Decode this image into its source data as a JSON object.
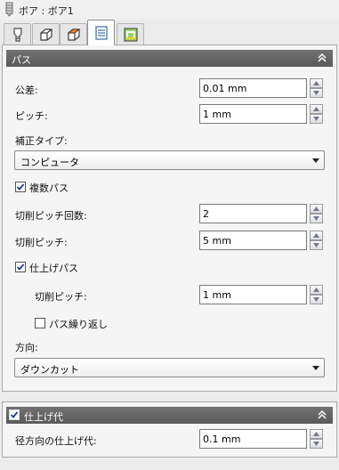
{
  "window": {
    "title": "ボア : ボア1"
  },
  "tabs": [
    {
      "icon": "tool-icon",
      "active": false
    },
    {
      "icon": "cube-outline-icon",
      "active": false
    },
    {
      "icon": "cube-orange-icon",
      "active": false
    },
    {
      "icon": "list-icon",
      "active": true
    },
    {
      "icon": "stock-icon",
      "active": false
    }
  ],
  "pass_section": {
    "title": "パス",
    "tolerance": {
      "label": "公差:",
      "value": "0.01 mm"
    },
    "pitch": {
      "label": "ピッチ:",
      "value": "1 mm"
    },
    "compensation": {
      "label": "補正タイプ:",
      "value": "コンピュータ"
    },
    "multi_pass": {
      "label": "複数パス",
      "checked": true
    },
    "cut_pitch_count": {
      "label": "切削ピッチ回数:",
      "value": "2"
    },
    "cut_pitch": {
      "label": "切削ピッチ:",
      "value": "5 mm"
    },
    "finish_pass": {
      "label": "仕上げパス",
      "checked": true
    },
    "finish_cut_pitch": {
      "label": "切削ピッチ:",
      "value": "1 mm"
    },
    "repeat_pass": {
      "label": "パス繰り返し",
      "checked": false
    },
    "direction": {
      "label": "方向:",
      "value": "ダウンカット"
    }
  },
  "stock_section": {
    "title": "仕上げ代",
    "checked": true,
    "radial_stock": {
      "label": "径方向の仕上げ代:",
      "value": "0.1 mm"
    }
  }
}
